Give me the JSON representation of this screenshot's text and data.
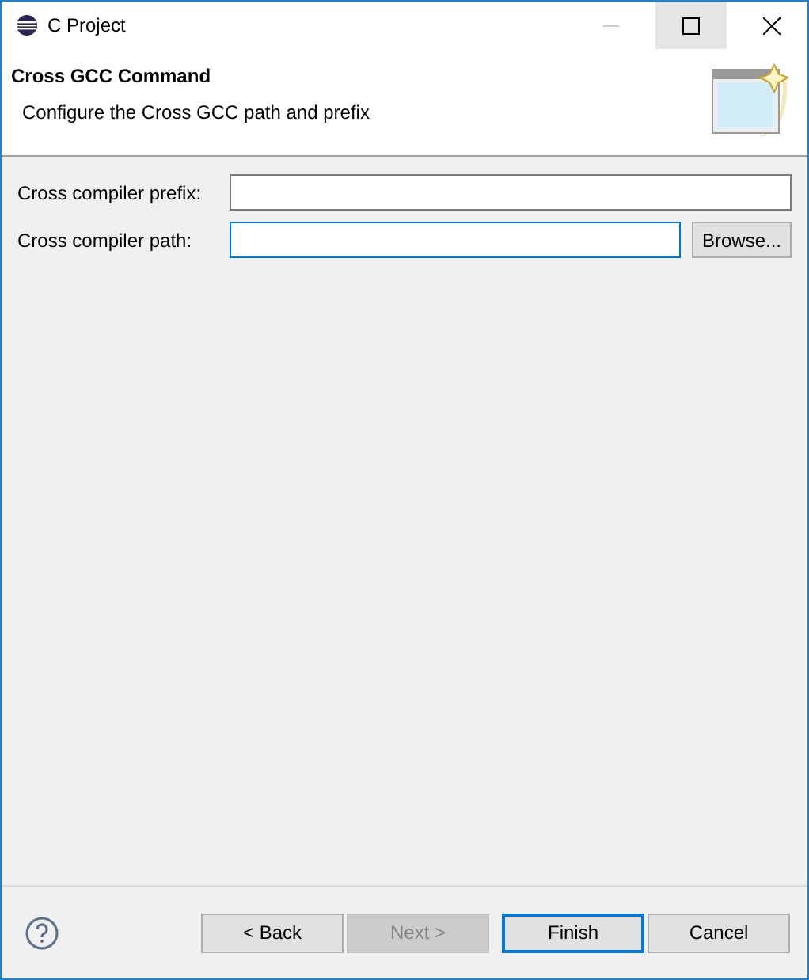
{
  "window": {
    "title": "C Project"
  },
  "header": {
    "title": "Cross GCC Command",
    "description": "Configure the Cross GCC path and prefix"
  },
  "fields": [
    {
      "label": "Cross compiler prefix:",
      "focused": false
    },
    {
      "label": "Cross compiler path:",
      "focused": true,
      "button": "Browse..."
    }
  ],
  "buttons": [
    {
      "label": "< Back",
      "disabled": false,
      "default": false
    },
    {
      "label": "Next >",
      "disabled": true,
      "default": false
    },
    {
      "label": "Finish",
      "disabled": false,
      "default": true
    },
    {
      "label": "Cancel",
      "disabled": false,
      "default": false
    }
  ]
}
